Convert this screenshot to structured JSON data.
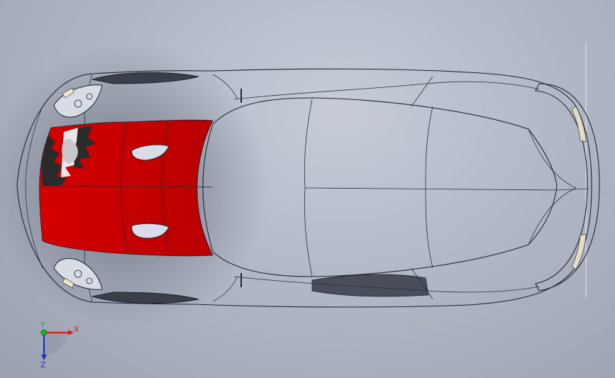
{
  "viewport": {
    "background": "#b2b8c6"
  },
  "model": {
    "body_color": "#c5c8d9",
    "accent_color": "#cc0000",
    "outline_color": "#1f2430"
  },
  "triad": {
    "x_label": "X",
    "y_label": "Y",
    "z_label": "Z",
    "x_color": "#d42020",
    "y_color": "#20b020",
    "z_color": "#2030c0"
  }
}
